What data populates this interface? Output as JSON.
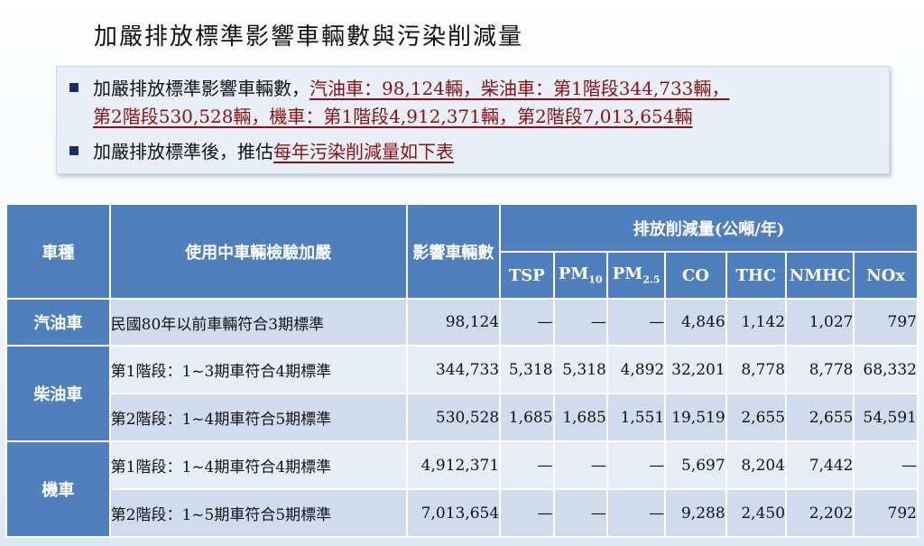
{
  "page_title": "加嚴排放標準影響車輛數與污染削減量",
  "bullets": {
    "b1_prefix": "加嚴排放標準影響車輛數，",
    "b1_line1_highlight": "汽油車：98,124輛，柴油車：第1階段344,733輛，",
    "b1_line2_highlight": "第2階段530,528輛，機車：第1階段4,912,371輛，第2階段7,013,654輛",
    "b2_prefix": "加嚴排放標準後，推估",
    "b2_highlight": "每年污染削減量如下表"
  },
  "table": {
    "headers": {
      "vehicle_type": "車種",
      "standard": "使用中車輛檢驗加嚴",
      "affected": "影響車輛數",
      "reduction": "排放削減量(公噸/年)",
      "tsp": "TSP",
      "pm10_base": "PM",
      "pm10_sub": "10",
      "pm25_base": "PM",
      "pm25_sub": "2.5",
      "co": "CO",
      "thc": "THC",
      "nmhc": "NMHC",
      "nox": "NOx"
    },
    "categories": {
      "gasoline": "汽油車",
      "diesel": "柴油車",
      "motorcycle": "機車"
    },
    "rows": [
      {
        "standard": "民國80年以前車輛符合3期標準",
        "affected": "98,124",
        "tsp": "—",
        "pm10": "—",
        "pm25": "—",
        "co": "4,846",
        "thc": "1,142",
        "nmhc": "1,027",
        "nox": "797"
      },
      {
        "standard": "第1階段：1~3期車符合4期標準",
        "affected": "344,733",
        "tsp": "5,318",
        "pm10": "5,318",
        "pm25": "4,892",
        "co": "32,201",
        "thc": "8,778",
        "nmhc": "8,778",
        "nox": "68,332"
      },
      {
        "standard": "第2階段：1~4期車符合5期標準",
        "affected": "530,528",
        "tsp": "1,685",
        "pm10": "1,685",
        "pm25": "1,551",
        "co": "19,519",
        "thc": "2,655",
        "nmhc": "2,655",
        "nox": "54,591"
      },
      {
        "standard": "第1階段：1~4期車符合4期標準",
        "affected": "4,912,371",
        "tsp": "—",
        "pm10": "—",
        "pm25": "—",
        "co": "5,697",
        "thc": "8,204",
        "nmhc": "7,442",
        "nox": "—"
      },
      {
        "standard": "第2階段：1~5期車符合5期標準",
        "affected": "7,013,654",
        "tsp": "—",
        "pm10": "—",
        "pm25": "—",
        "co": "9,288",
        "thc": "2,450",
        "nmhc": "2,202",
        "nox": "792"
      }
    ]
  },
  "colors": {
    "header_blue": "#4f80bd",
    "row_dark": "#d0dcee",
    "row_light": "#e6edf6",
    "highlight_red": "#8b1010",
    "bullet_square": "#1b2b6b"
  }
}
